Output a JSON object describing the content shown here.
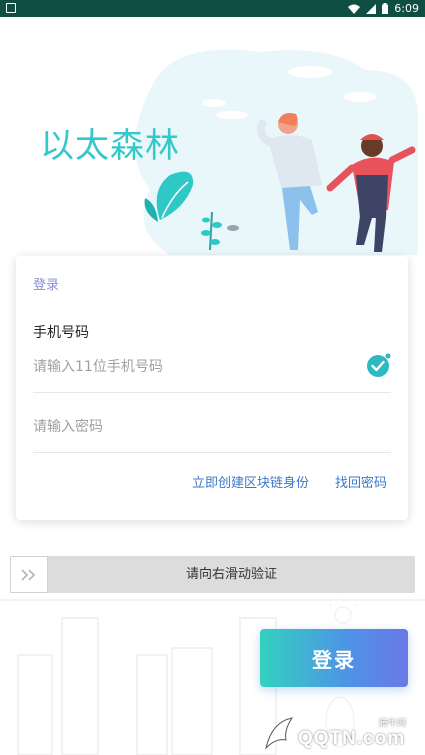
{
  "status_bar": {
    "time": "6:09"
  },
  "app": {
    "name": "以太森林"
  },
  "card": {
    "title": "登录",
    "phone_label": "手机号码",
    "phone_placeholder": "请输入11位手机号码",
    "password_placeholder": "请输入密码",
    "create_link": "立即创建区块链身份",
    "forgot_link": "找回密码"
  },
  "slider": {
    "text": "请向右滑动验证"
  },
  "login_button": "登录",
  "watermark": {
    "text": "QQTN.com",
    "sub": "腾牛网"
  },
  "colors": {
    "accent": "#35c8c9",
    "link": "#3d78c7",
    "title": "#8b8fd6",
    "status_bar": "#0f4f43"
  },
  "icons": [
    "wifi-icon",
    "signal-icon",
    "battery-icon",
    "check-icon",
    "double-chevron-right-icon"
  ]
}
